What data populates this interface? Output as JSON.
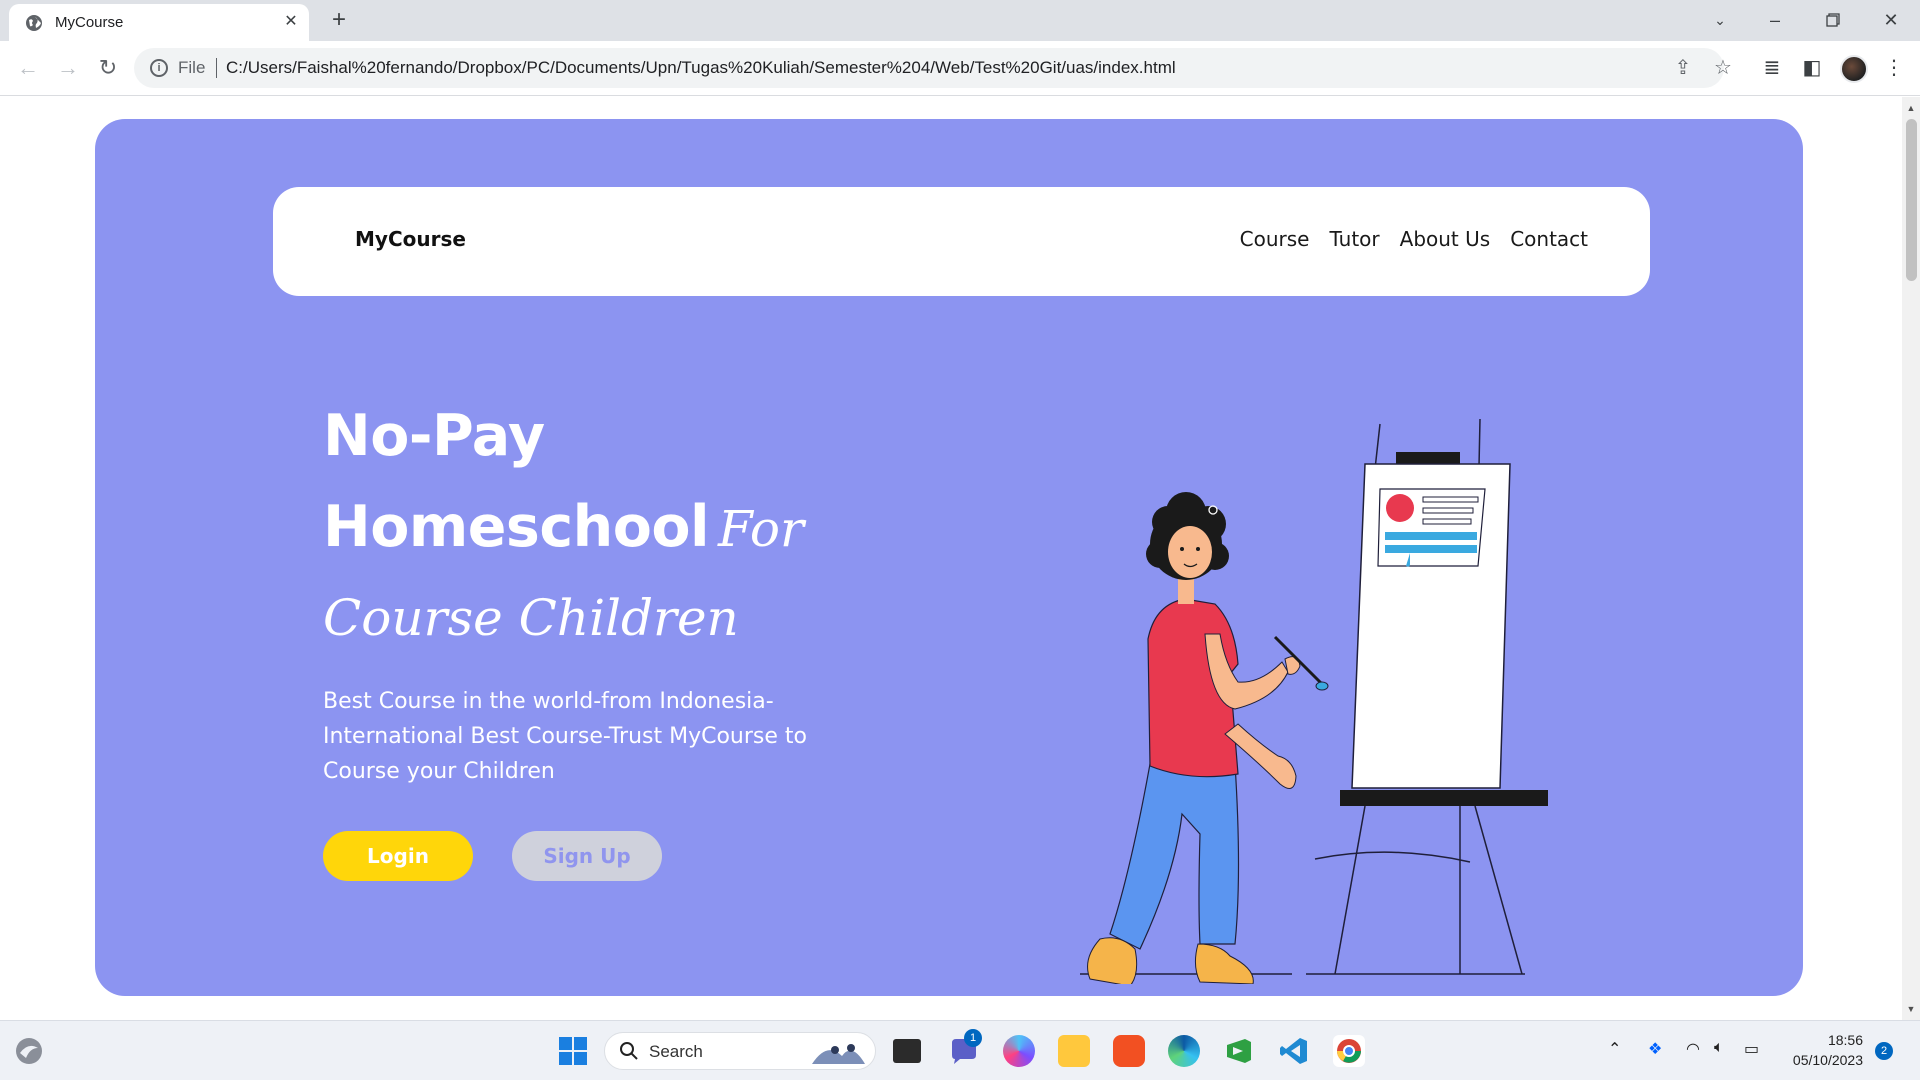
{
  "browser": {
    "tab_title": "MyCourse",
    "address_scheme": "File",
    "url": "C:/Users/Faishal%20fernando/Dropbox/PC/Documents/Upn/Tugas%20Kuliah/Semester%204/Web/Test%20Git/uas/index.html"
  },
  "site": {
    "brand": "MyCourse",
    "menu": [
      "Course",
      "Tutor",
      "About Us",
      "Contact"
    ],
    "headline": {
      "line1": "No-Pay",
      "line2_bold": "Homeschool",
      "line2_script": "For",
      "line3_script": "Course Children"
    },
    "subtitle": "Best Course in the world-from Indonesia-International Best Course-Trust MyCourse to Course your Children",
    "login_label": "Login",
    "signup_label": "Sign Up",
    "colors": {
      "hero_bg": "#8c94f1",
      "login_bg": "#ffd60a",
      "signup_bg": "#cfd1dc"
    }
  },
  "taskbar": {
    "search_label": "Search",
    "chat_badge": "1",
    "time": "18:56",
    "date": "05/10/2023",
    "notification_count": "2"
  }
}
